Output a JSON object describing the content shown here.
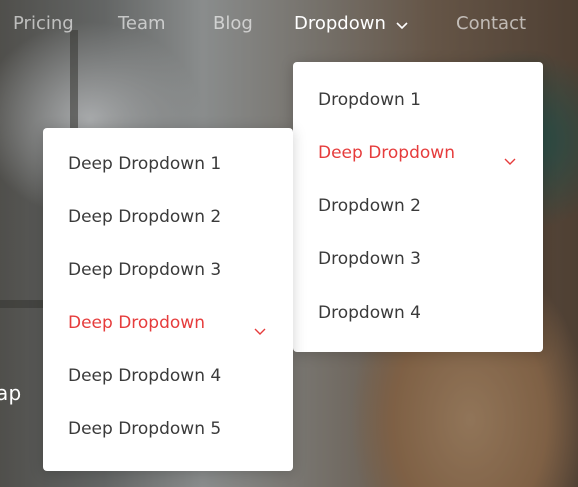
{
  "colors": {
    "accent": "#e63c3c",
    "menu_text": "#3a3a3a",
    "nav_text": "#ffffff"
  },
  "nav": {
    "items": [
      {
        "label": "Pricing"
      },
      {
        "label": "Team"
      },
      {
        "label": "Blog"
      },
      {
        "label": "Dropdown",
        "icon": "chevron-down-icon"
      },
      {
        "label": "Contact"
      }
    ]
  },
  "dropdown": {
    "items": [
      {
        "label": "Dropdown 1"
      },
      {
        "label": "Deep Dropdown",
        "icon": "chevron-down-icon"
      },
      {
        "label": "Dropdown 2"
      },
      {
        "label": "Dropdown 3"
      },
      {
        "label": "Dropdown 4"
      }
    ]
  },
  "deep_dropdown": {
    "items": [
      {
        "label": "Deep Dropdown 1"
      },
      {
        "label": "Deep Dropdown 2"
      },
      {
        "label": "Deep Dropdown 3"
      },
      {
        "label": "Deep Dropdown",
        "icon": "chevron-down-icon"
      },
      {
        "label": "Deep Dropdown 4"
      },
      {
        "label": "Deep Dropdown 5"
      }
    ]
  },
  "hero": {
    "text_fragment": "ap"
  }
}
